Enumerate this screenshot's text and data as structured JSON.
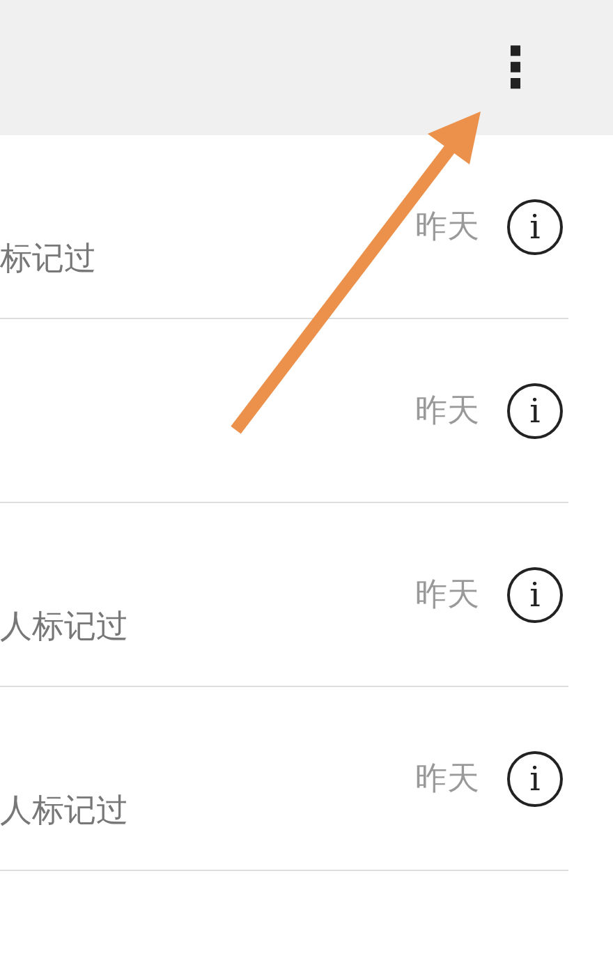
{
  "header": {
    "menu": "⋮"
  },
  "rows": [
    {
      "subtitle": "标记过",
      "time": "昨天",
      "info": "i"
    },
    {
      "time": "昨天",
      "info": "i"
    },
    {
      "subtitle": "人标记过",
      "time": "昨天",
      "info": "i"
    },
    {
      "subtitle": "人标记过",
      "time": "昨天",
      "info": "i"
    }
  ]
}
